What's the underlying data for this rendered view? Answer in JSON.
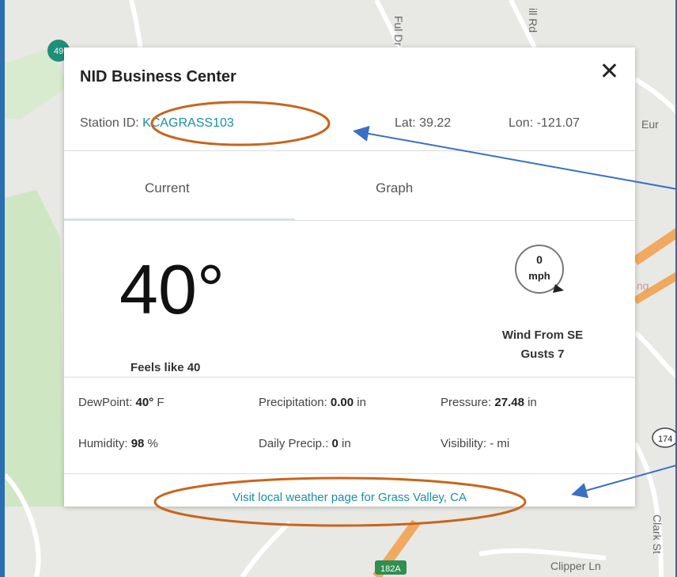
{
  "map": {
    "labels": [
      "Ful Dr",
      "ill Rd",
      "Eur",
      "ng",
      "174",
      "Clark St",
      "182A",
      "Clipper Ln",
      "49"
    ]
  },
  "popup": {
    "title": "NID Business Center",
    "close_glyph": "✕",
    "station_label": "Station ID:",
    "station_id": "KCAGRASS103",
    "lat_label": "Lat:",
    "lat": "39.22",
    "lon_label": "Lon:",
    "lon": "-121.07",
    "tabs": [
      "Current",
      "Graph"
    ],
    "active_tab": "Current",
    "temperature": "40°",
    "feels_like": "Feels like 40",
    "wind": {
      "speed": "0",
      "unit": "mph",
      "direction": "Wind From SE",
      "gusts": "Gusts 7"
    },
    "stats": {
      "dewpoint_label": "DewPoint:",
      "dewpoint_value": "40°",
      "dewpoint_unit": "F",
      "precip_label": "Precipitation:",
      "precip_value": "0.00",
      "precip_unit": "in",
      "pressure_label": "Pressure:",
      "pressure_value": "27.48",
      "pressure_unit": "in",
      "humidity_label": "Humidity:",
      "humidity_value": "98",
      "humidity_unit": "%",
      "daily_label": "Daily Precip.:",
      "daily_value": "0",
      "daily_unit": "in",
      "visibility_label": "Visibility:",
      "visibility_value": "-",
      "visibility_unit": "mi"
    },
    "footer_link": "Visit local weather page for Grass Valley, CA"
  },
  "colors": {
    "accent": "#1a8fa0",
    "annotation_orange": "#c8651b",
    "annotation_arrow": "#3a6fc4",
    "frame": "#2a6fb0"
  }
}
